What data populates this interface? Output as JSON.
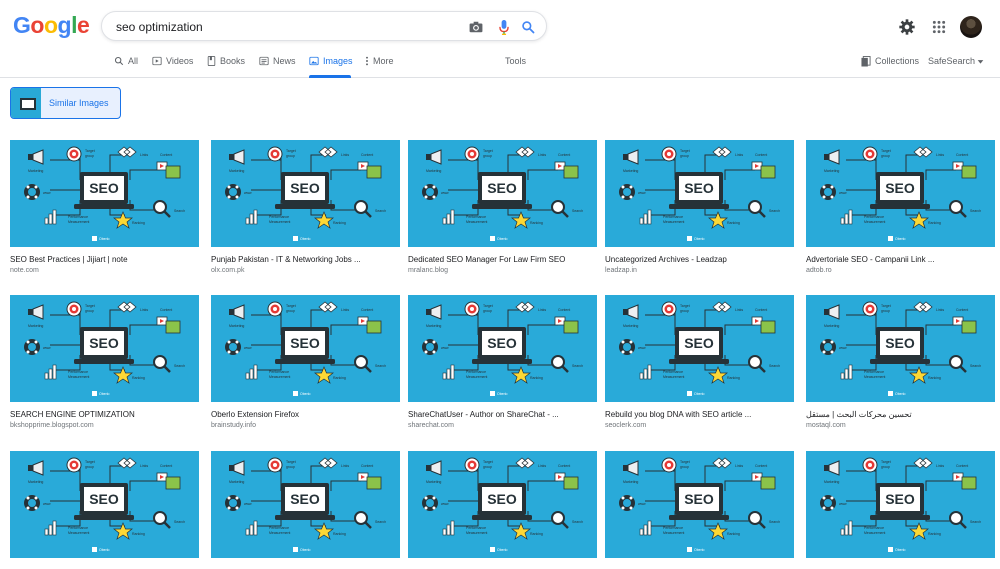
{
  "logo": {
    "letters": [
      "G",
      "o",
      "o",
      "g",
      "l",
      "e"
    ],
    "colors": [
      "#4285F4",
      "#EA4335",
      "#FBBC05",
      "#4285F4",
      "#34A853",
      "#EA4335"
    ]
  },
  "search": {
    "query": "seo optimization"
  },
  "tabs": [
    {
      "label": "All",
      "icon": "search-icon"
    },
    {
      "label": "Videos",
      "icon": "video-icon"
    },
    {
      "label": "Books",
      "icon": "book-icon"
    },
    {
      "label": "News",
      "icon": "news-icon"
    },
    {
      "label": "Images",
      "icon": "image-icon",
      "active": true
    },
    {
      "label": "More",
      "icon": "more-vert-icon"
    },
    {
      "label": "Tools"
    }
  ],
  "right_tools": {
    "collections": "Collections",
    "safesearch": "SafeSearch"
  },
  "similar": {
    "label": "Similar Images"
  },
  "image_text": {
    "marketing": "Marketing",
    "target": "Target",
    "group": "group",
    "links": "Links",
    "content": "Content",
    "www": "www",
    "seo": "SEO",
    "performance": "Performance",
    "measurement": "Measurement",
    "ranking": "Ranking",
    "search": "Search",
    "oberlo": "Oberlo"
  },
  "results": [
    {
      "title": "SEO Best Practices | Jijiart | note",
      "domain": "note.com"
    },
    {
      "title": "Punjab Pakistan - IT & Networking Jobs ...",
      "domain": "olx.com.pk"
    },
    {
      "title": "Dedicated SEO Manager For Law Firm SEO",
      "domain": "mralanc.blog"
    },
    {
      "title": "Uncategorized Archives - Leadzap",
      "domain": "leadzap.in"
    },
    {
      "title": "Advertoriale SEO - Campanii Link ...",
      "domain": "adtob.ro"
    },
    {
      "title": "SEARCH ENGINE OPTIMIZATION",
      "domain": "bkshopprime.blogspot.com"
    },
    {
      "title": "Oberlo Extension Firefox",
      "domain": "brainstudy.info"
    },
    {
      "title": "ShareChatUser - Author on ShareChat - ...",
      "domain": "sharechat.com"
    },
    {
      "title": "Rebuild you blog DNA with SEO article ...",
      "domain": "seoclerk.com"
    },
    {
      "title": "تحسين محركات البحث | مستقل",
      "domain": "mostaql.com"
    },
    {
      "title": "",
      "domain": ""
    },
    {
      "title": "",
      "domain": ""
    },
    {
      "title": "",
      "domain": ""
    },
    {
      "title": "",
      "domain": ""
    },
    {
      "title": "",
      "domain": ""
    }
  ]
}
